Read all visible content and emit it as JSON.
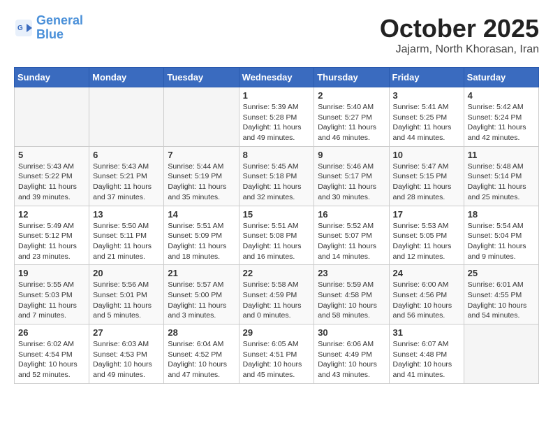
{
  "header": {
    "logo_line1": "General",
    "logo_line2": "Blue",
    "month": "October 2025",
    "location": "Jajarm, North Khorasan, Iran"
  },
  "weekdays": [
    "Sunday",
    "Monday",
    "Tuesday",
    "Wednesday",
    "Thursday",
    "Friday",
    "Saturday"
  ],
  "weeks": [
    [
      {
        "day": "",
        "info": ""
      },
      {
        "day": "",
        "info": ""
      },
      {
        "day": "",
        "info": ""
      },
      {
        "day": "1",
        "info": "Sunrise: 5:39 AM\nSunset: 5:28 PM\nDaylight: 11 hours\nand 49 minutes."
      },
      {
        "day": "2",
        "info": "Sunrise: 5:40 AM\nSunset: 5:27 PM\nDaylight: 11 hours\nand 46 minutes."
      },
      {
        "day": "3",
        "info": "Sunrise: 5:41 AM\nSunset: 5:25 PM\nDaylight: 11 hours\nand 44 minutes."
      },
      {
        "day": "4",
        "info": "Sunrise: 5:42 AM\nSunset: 5:24 PM\nDaylight: 11 hours\nand 42 minutes."
      }
    ],
    [
      {
        "day": "5",
        "info": "Sunrise: 5:43 AM\nSunset: 5:22 PM\nDaylight: 11 hours\nand 39 minutes."
      },
      {
        "day": "6",
        "info": "Sunrise: 5:43 AM\nSunset: 5:21 PM\nDaylight: 11 hours\nand 37 minutes."
      },
      {
        "day": "7",
        "info": "Sunrise: 5:44 AM\nSunset: 5:19 PM\nDaylight: 11 hours\nand 35 minutes."
      },
      {
        "day": "8",
        "info": "Sunrise: 5:45 AM\nSunset: 5:18 PM\nDaylight: 11 hours\nand 32 minutes."
      },
      {
        "day": "9",
        "info": "Sunrise: 5:46 AM\nSunset: 5:17 PM\nDaylight: 11 hours\nand 30 minutes."
      },
      {
        "day": "10",
        "info": "Sunrise: 5:47 AM\nSunset: 5:15 PM\nDaylight: 11 hours\nand 28 minutes."
      },
      {
        "day": "11",
        "info": "Sunrise: 5:48 AM\nSunset: 5:14 PM\nDaylight: 11 hours\nand 25 minutes."
      }
    ],
    [
      {
        "day": "12",
        "info": "Sunrise: 5:49 AM\nSunset: 5:12 PM\nDaylight: 11 hours\nand 23 minutes."
      },
      {
        "day": "13",
        "info": "Sunrise: 5:50 AM\nSunset: 5:11 PM\nDaylight: 11 hours\nand 21 minutes."
      },
      {
        "day": "14",
        "info": "Sunrise: 5:51 AM\nSunset: 5:09 PM\nDaylight: 11 hours\nand 18 minutes."
      },
      {
        "day": "15",
        "info": "Sunrise: 5:51 AM\nSunset: 5:08 PM\nDaylight: 11 hours\nand 16 minutes."
      },
      {
        "day": "16",
        "info": "Sunrise: 5:52 AM\nSunset: 5:07 PM\nDaylight: 11 hours\nand 14 minutes."
      },
      {
        "day": "17",
        "info": "Sunrise: 5:53 AM\nSunset: 5:05 PM\nDaylight: 11 hours\nand 12 minutes."
      },
      {
        "day": "18",
        "info": "Sunrise: 5:54 AM\nSunset: 5:04 PM\nDaylight: 11 hours\nand 9 minutes."
      }
    ],
    [
      {
        "day": "19",
        "info": "Sunrise: 5:55 AM\nSunset: 5:03 PM\nDaylight: 11 hours\nand 7 minutes."
      },
      {
        "day": "20",
        "info": "Sunrise: 5:56 AM\nSunset: 5:01 PM\nDaylight: 11 hours\nand 5 minutes."
      },
      {
        "day": "21",
        "info": "Sunrise: 5:57 AM\nSunset: 5:00 PM\nDaylight: 11 hours\nand 3 minutes."
      },
      {
        "day": "22",
        "info": "Sunrise: 5:58 AM\nSunset: 4:59 PM\nDaylight: 11 hours\nand 0 minutes."
      },
      {
        "day": "23",
        "info": "Sunrise: 5:59 AM\nSunset: 4:58 PM\nDaylight: 10 hours\nand 58 minutes."
      },
      {
        "day": "24",
        "info": "Sunrise: 6:00 AM\nSunset: 4:56 PM\nDaylight: 10 hours\nand 56 minutes."
      },
      {
        "day": "25",
        "info": "Sunrise: 6:01 AM\nSunset: 4:55 PM\nDaylight: 10 hours\nand 54 minutes."
      }
    ],
    [
      {
        "day": "26",
        "info": "Sunrise: 6:02 AM\nSunset: 4:54 PM\nDaylight: 10 hours\nand 52 minutes."
      },
      {
        "day": "27",
        "info": "Sunrise: 6:03 AM\nSunset: 4:53 PM\nDaylight: 10 hours\nand 49 minutes."
      },
      {
        "day": "28",
        "info": "Sunrise: 6:04 AM\nSunset: 4:52 PM\nDaylight: 10 hours\nand 47 minutes."
      },
      {
        "day": "29",
        "info": "Sunrise: 6:05 AM\nSunset: 4:51 PM\nDaylight: 10 hours\nand 45 minutes."
      },
      {
        "day": "30",
        "info": "Sunrise: 6:06 AM\nSunset: 4:49 PM\nDaylight: 10 hours\nand 43 minutes."
      },
      {
        "day": "31",
        "info": "Sunrise: 6:07 AM\nSunset: 4:48 PM\nDaylight: 10 hours\nand 41 minutes."
      },
      {
        "day": "",
        "info": ""
      }
    ]
  ]
}
